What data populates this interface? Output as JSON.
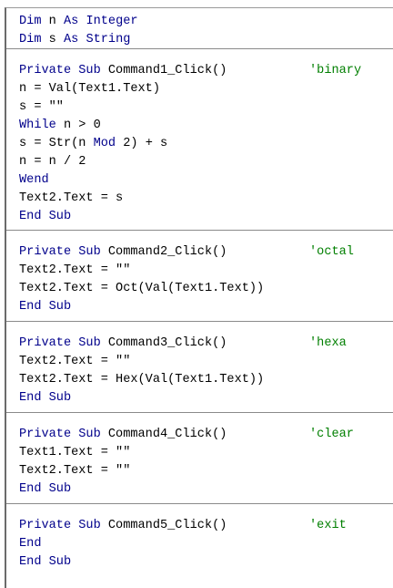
{
  "colors": {
    "keyword": "#00008b",
    "text": "#000000",
    "comment": "#007f00",
    "separator": "#8a8a8a",
    "background": "#ffffff"
  },
  "declarations": {
    "line1_kw1": "Dim",
    "line1_txt1": " n ",
    "line1_kw2": "As Integer",
    "line2_kw1": "Dim",
    "line2_txt1": " s ",
    "line2_kw2": "As String"
  },
  "proc1": {
    "kw_private": "Private Sub",
    "name": " Command1_Click()",
    "comment": "'binary",
    "l2": "n = Val(Text1.Text)",
    "l3": "s = \"\"",
    "l4_kw": "While",
    "l4_txt": " n > 0",
    "l5_a": "s = Str(n ",
    "l5_kw": "Mod",
    "l5_b": " 2) + s",
    "l6": "n = n / 2",
    "l7_kw": "Wend",
    "l8": "Text2.Text = s",
    "l9_kw": "End Sub"
  },
  "proc2": {
    "kw_private": "Private Sub",
    "name": " Command2_Click()",
    "comment": "'octal",
    "l2": "Text2.Text = \"\"",
    "l3": "Text2.Text = Oct(Val(Text1.Text))",
    "l4_kw": "End Sub"
  },
  "proc3": {
    "kw_private": "Private Sub",
    "name": " Command3_Click()",
    "comment": "'hexa",
    "l2": "Text2.Text = \"\"",
    "l3": "Text2.Text = Hex(Val(Text1.Text))",
    "l4_kw": "End Sub"
  },
  "proc4": {
    "kw_private": "Private Sub",
    "name": " Command4_Click()",
    "comment": "'clear",
    "l2": "Text1.Text = \"\"",
    "l3": "Text2.Text = \"\"",
    "l4_kw": "End Sub"
  },
  "proc5": {
    "kw_private": "Private Sub",
    "name": " Command5_Click()",
    "comment": "'exit",
    "l2_kw": "End",
    "l3_kw": "End Sub"
  }
}
